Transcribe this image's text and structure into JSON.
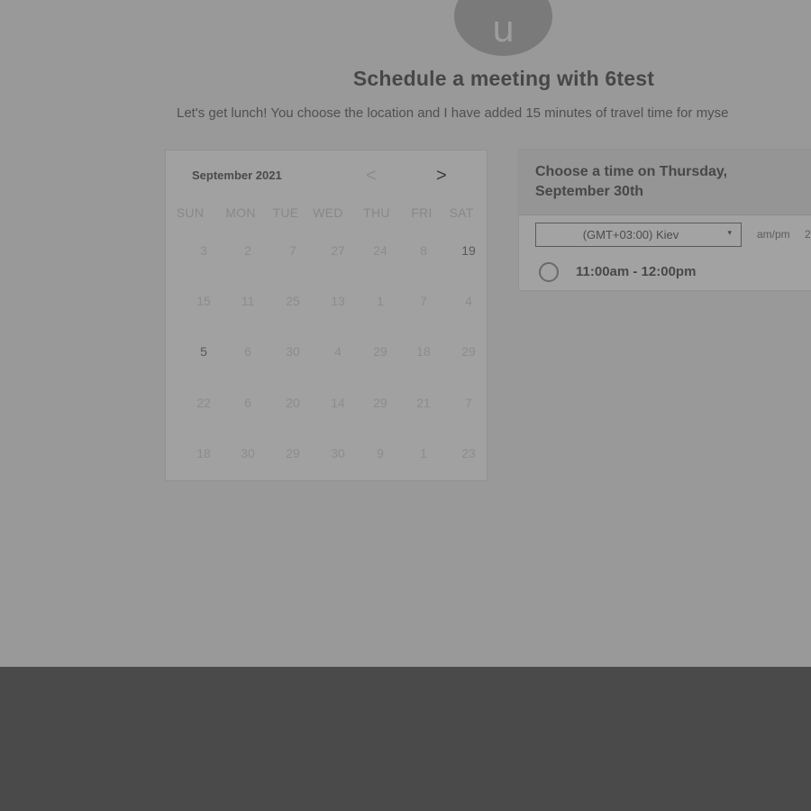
{
  "header": {
    "avatar_letter": "u",
    "title": "Schedule a meeting with 6test",
    "description": "Let's get lunch! You choose the location and I have added 15 minutes of travel time for myse"
  },
  "calendar": {
    "month_label": "September 2021",
    "prev_icon": "chevron-left-icon",
    "next_icon": "chevron-right-icon",
    "prev_glyph": "<",
    "next_glyph": ">",
    "weekdays": [
      "SUN",
      "MON",
      "TUE",
      "WED",
      "THU",
      "FRI",
      "SAT"
    ],
    "weeks": [
      [
        "3",
        "2",
        "7",
        "27",
        "24",
        "8",
        "19"
      ],
      [
        "15",
        "11",
        "25",
        "13",
        "1",
        "7",
        "4"
      ],
      [
        "5",
        "6",
        "30",
        "4",
        "29",
        "18",
        "29"
      ],
      [
        "22",
        "6",
        "20",
        "14",
        "29",
        "21",
        "7"
      ],
      [
        "18",
        "30",
        "29",
        "30",
        "9",
        "1",
        "23"
      ]
    ],
    "emphasized_days": [
      "19",
      "5"
    ]
  },
  "time_panel": {
    "heading": "Choose a time on Thursday, September 30th",
    "timezone": "(GMT+03:00) Kiev",
    "timezone_caret": "▾",
    "format_label": "am/pm",
    "format_alt": "2",
    "slots": [
      "11:00am - 12:00pm"
    ]
  },
  "colors": {
    "overlay": "#999999",
    "footer": "#4a4a4a"
  }
}
